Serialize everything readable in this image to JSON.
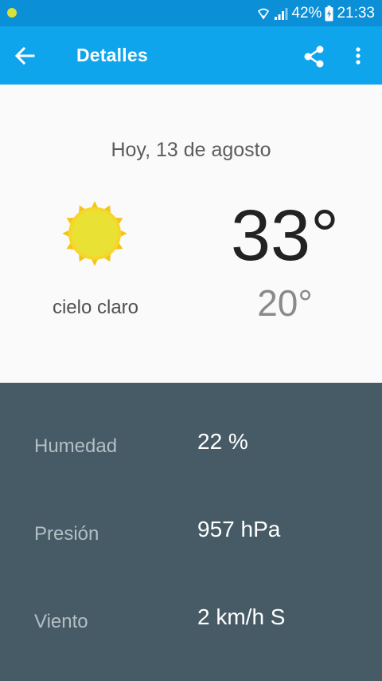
{
  "status_bar": {
    "battery": "42%",
    "time": "21:33"
  },
  "app_bar": {
    "title": "Detalles",
    "back_icon": "arrow-left-icon",
    "share_icon": "share-icon",
    "menu_icon": "more-vert-icon"
  },
  "forecast": {
    "date": "Hoy, 13 de agosto",
    "condition": "cielo claro",
    "condition_icon": "sun-icon",
    "temp_max": "33°",
    "temp_min": "20°"
  },
  "details": [
    {
      "label": "Humedad",
      "value": "22 %"
    },
    {
      "label": "Presión",
      "value": "957 hPa"
    },
    {
      "label": "Viento",
      "value": "2 km/h S"
    }
  ],
  "colors": {
    "status_bar": "#0b8fd6",
    "app_bar": "#0fa5ec",
    "details_bg": "#475b66",
    "sun_core": "#e9e234",
    "sun_rays": "#f3c51a"
  }
}
